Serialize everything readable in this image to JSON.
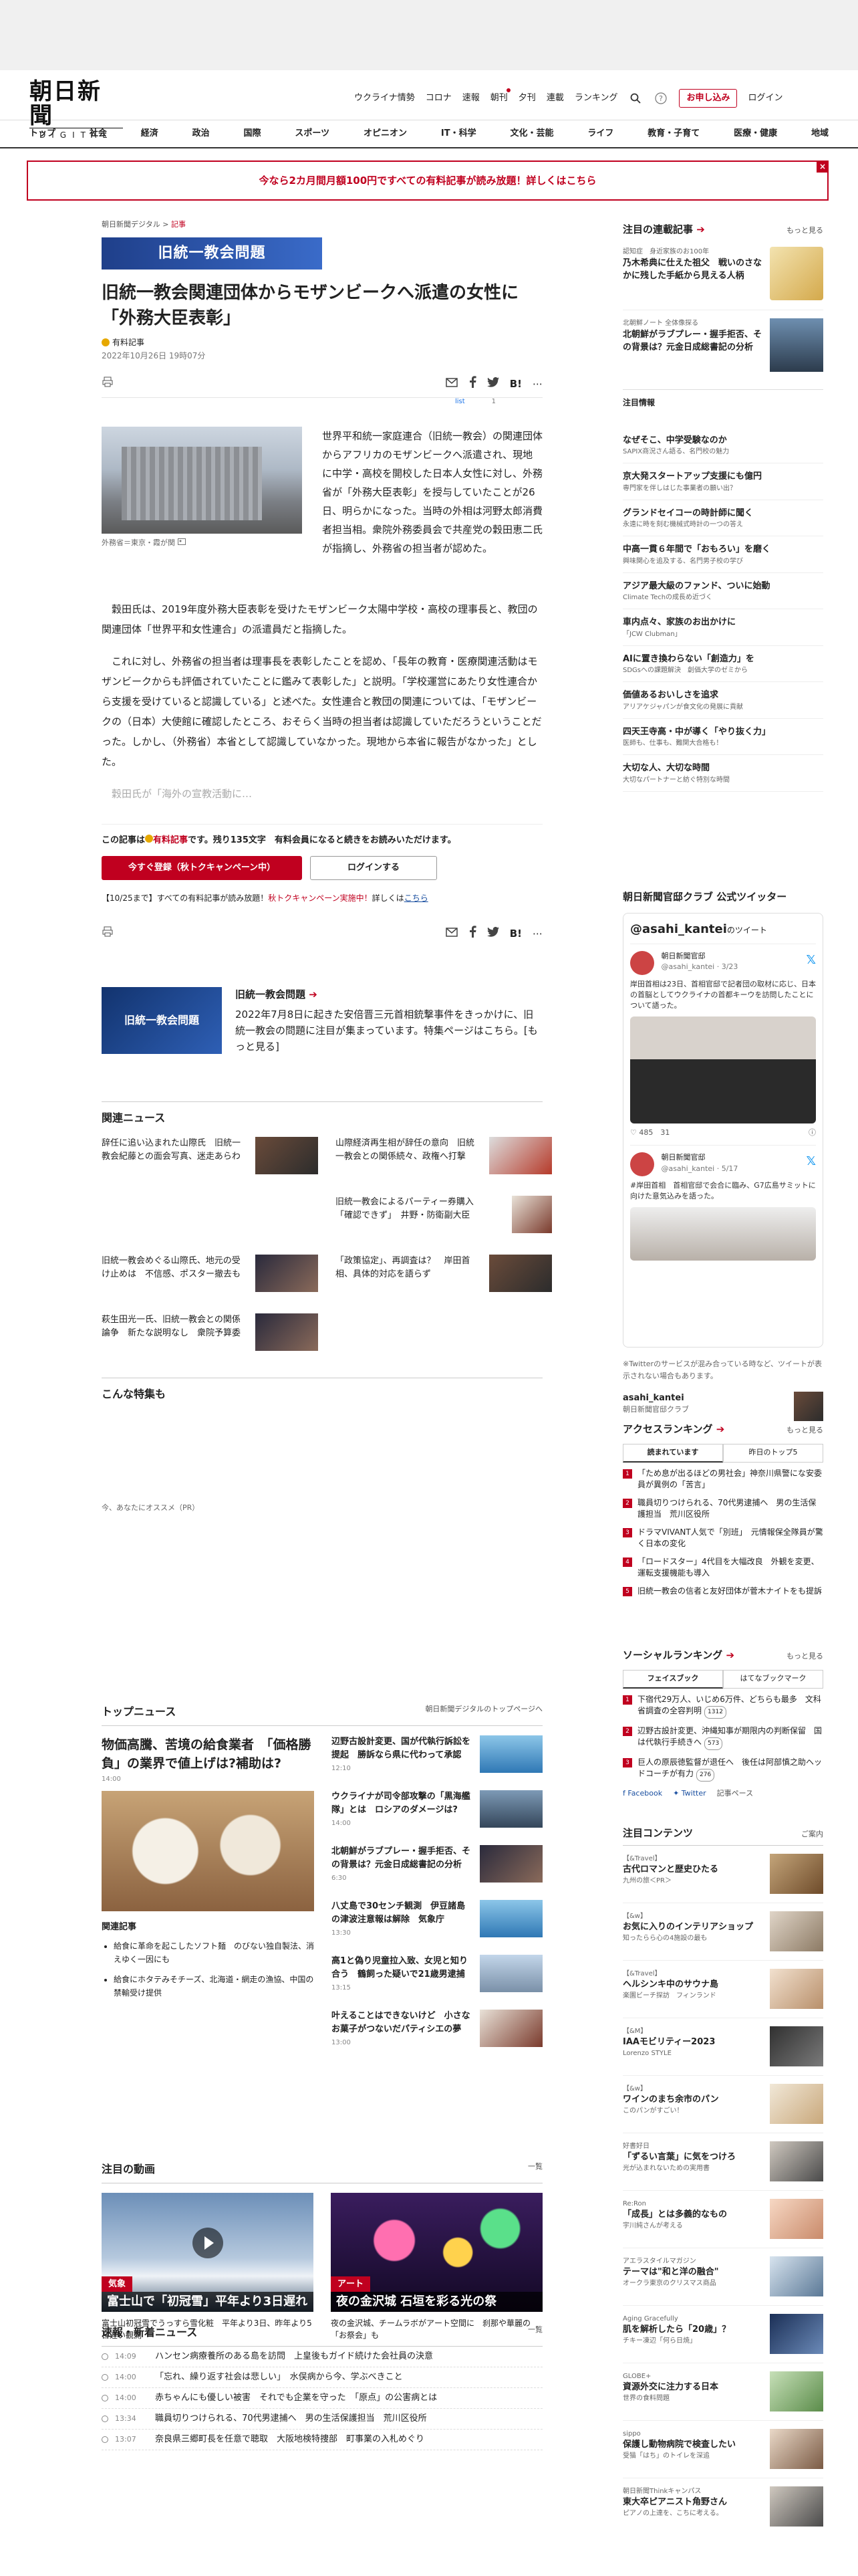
{
  "header": {
    "logo_main": "朝日新聞",
    "logo_sub": "DIGITAL",
    "util_links": [
      "ウクライナ情勢",
      "コロナ",
      "速報",
      "朝刊",
      "夕刊",
      "連載",
      "ランキング"
    ],
    "subscribe": "お申し込み",
    "login": "ログイン"
  },
  "nav": [
    "トップ",
    "社会",
    "経済",
    "政治",
    "国際",
    "スポーツ",
    "オピニオン",
    "IT・科学",
    "文化・芸能",
    "ライフ",
    "教育・子育て",
    "医療・健康",
    "地域"
  ],
  "banner": {
    "text": "今なら2カ月間月額100円ですべての有料記事が読み放題！詳しくはこちら",
    "close": "×"
  },
  "article": {
    "crumb_site": "朝日新聞デジタル",
    "crumb_sep": ">",
    "crumb_cat": "記事",
    "tag": "旧統一教会問題",
    "title": "旧統一教会関連団体からモザンビークへ派遣の女性に「外務大臣表彰」",
    "paid_label": "有料記事",
    "date": "2022年10月26日 19時07分",
    "share_small": "list",
    "share_count": "1",
    "photo_caption": "外務省＝東京・霞が関",
    "lead": "世界平和統一家庭連合（旧統一教会）の関連団体からアフリカのモザンビークへ派遣され、現地に中学・高校を開校した日本人女性に対し、外務省が「外務大臣表彰」を授与していたことが26日、明らかになった。当時の外相は河野太郎消費者担当相。衆院外務委員会で共産党の穀田恵二氏が指摘し、外務省の担当者が認めた。",
    "para1": "穀田氏は、2019年度外務大臣表彰を受けたモザンビーク太陽中学校・高校の理事長と、教団の関連団体「世界平和女性連合」の派遣員だと指摘した。",
    "para2": "これに対し、外務省の担当者は理事長を表彰したことを認め、「長年の教育・医療関連活動はモザンビークからも評価されていたことに鑑みて表彰した」と説明。「学校運営にあたり女性連合から支援を受けていると認識している」と述べた。女性連合と教団の関連については、「モザンビークの（日本）大使館に確認したところ、おそらく当時の担当者は認識していただろうということだった。しかし、（外務省）本省として認識していなかった。現地から本省に報告がなかった」とした。",
    "para3": "穀田氏が「海外の宣教活動に…",
    "pay_msg_a": "この記事は",
    "pay_msg_b": "有料記事",
    "pay_msg_c": "です。残り135文字　有料会員になると続きをお読みいただけます。",
    "btn_register": "今すぐ登録（秋トクキャンペーン中）",
    "btn_login": "ログインする",
    "note_a": "【10/25まで】すべての有料記事が読み放題！",
    "note_b": "秋トクキャンペーン実施中！",
    "note_c": "詳しくは",
    "note_d": "こちら"
  },
  "feature": {
    "img_text": "旧統一教会問題",
    "title": "旧統一教会問題",
    "desc": "2022年7月8日に起きた安倍晋三元首相銃撃事件をきっかけに、旧統一教会の問題に注目が集まっています。特集ページはこちら。[もっと見る]"
  },
  "related": {
    "heading": "関連ニュース",
    "items": [
      "辞任に追い込まれた山際氏　旧統一教会紀藤との面会写真、迷走あらわ",
      "山際経済再生相が辞任の意向　旧統一教会との関係続々、政権へ打撃",
      "旧統一教会によるパーティー券購入「確認できず」　井野・防衛副大臣",
      "旧統一教会めぐる山際氏、地元の受け止めは　不信感、ポスター撤去も",
      "「政策協定」、再調査は？　岸田首相、具体的対応を語らず",
      "萩生田光一氏、旧統一教会との関係論争　新たな説明なし　衆院予算委"
    ]
  },
  "konna": "こんな特集も",
  "pr": "今、あなたにオススメ（PR）",
  "topnews": {
    "heading": "トップニュース",
    "more": "朝日新聞デジタルのトップページへ",
    "lead_title": "物価高騰、苦境の給食業者　「価格勝負」の業界で値上げは?補助は?",
    "lead_time": "14:00",
    "kanren_heading": "関連記事",
    "kanren": [
      "給食に革命を起こしたソフト麺　のびない独自製法、消えゆく一因にも",
      "給食にホタテみそチーズ、北海道・網走の漁協、中国の禁輸受け提供"
    ],
    "items": [
      {
        "title": "辺野古設計変更、国が代執行訴訟を提起　勝訴なら県に代わって承認",
        "time": "12:10"
      },
      {
        "title": "ウクライナが司令部攻撃の「黒海艦隊」とは　ロシアのダメージは?",
        "time": "14:00"
      },
      {
        "title": "北朝鮮がラブプレー・握手拒否、その背景は？元金日成総書記の分析",
        "time": "6:30"
      },
      {
        "title": "八丈島で30センチ観測　伊豆諸島の津波注意報は解除　気象庁",
        "time": "13:30"
      },
      {
        "title": "高1と偽り児童拉入致、女児と知り合う　鶴飼った疑いで21歳男逮捕",
        "time": "13:15"
      },
      {
        "title": "叶えることはできないけど　小さなお菓子がつないだパティシエの夢",
        "time": "13:00"
      }
    ]
  },
  "videos": {
    "heading": "注目の動画",
    "more": "一覧",
    "items": [
      {
        "badge": "気象",
        "caption": "富士山で「初冠雪」平年より3日遅れ",
        "desc": "富士山初冠雪でうっすら雪化粧　平年より3日、昨年より5日遅い観測"
      },
      {
        "badge": "アート",
        "caption": "夜の金沢城 石垣を彩る光の祭",
        "desc": "夜の金沢城、チームラボがアート空間に　刹那や華麗の「お祭会」も"
      }
    ]
  },
  "breaking": {
    "heading": "速報・新着ニュース",
    "more": "一覧",
    "items": [
      {
        "time": "14:09",
        "title": "ハンセン病療養所のある島を訪問　上皇後もガイド続けた会社員の決意"
      },
      {
        "time": "14:00",
        "title": "「忘れ、繰り返す社会は悲しい」　水俣病から今、学ぶべきこと"
      },
      {
        "time": "14:00",
        "title": "赤ちゃんにも優しい被害　それでも企業を守った　「原点」の公害病とは"
      },
      {
        "time": "13:34",
        "title": "職員切りつけられる、70代男逮捕へ　男の生活保護担当　荒川区役所"
      },
      {
        "time": "13:07",
        "title": "奈良県三郷町長を任意で聴取　大阪地検特捜部　町事業の入札めぐり"
      }
    ]
  },
  "side_series": {
    "heading": "注目の連載記事",
    "more": "もっと見る",
    "items": [
      {
        "kicker": "認知症　身近家族のお100年",
        "title": "乃木希典に仕えた祖父　戦いのさなかに残した手紙から見える人柄"
      },
      {
        "kicker": "北朝鮮ノート 全体像探る",
        "title": "北朝鮮がラブプレー・握手拒否、その背景は？元金日成総書記の分析"
      }
    ],
    "chuui": "注目情報",
    "ads": [
      {
        "title": "なぜそこ、中学受験なのか",
        "sub": "SAPIX商況さん語る、名門校の魅力"
      },
      {
        "title": "京大発スタートアップ支援にも億円",
        "sub": "専門家を伴しはじた事業者の願い出？"
      },
      {
        "title": "グランドセイコーの時計師に聞く",
        "sub": "永遠に時を刻む機械式時計の一つの答え"
      },
      {
        "title": "中高一貫６年間で「おもろい」を磨く",
        "sub": "興味関心を追及する、名門男子校の学び"
      },
      {
        "title": "アジア最大級のファンド、ついに始動",
        "sub": "Climate Techの成長め近づく"
      },
      {
        "title": "車内点々、家族のお出かけに",
        "sub": "「JCW Clubman」"
      },
      {
        "title": "AIに置き換わらない「創造力」を",
        "sub": "SDGsへの課題解決　創価大学のゼミから"
      },
      {
        "title": "価値あるおいしさを追求",
        "sub": "アリアケジャパンが食文化の発展に貢献"
      },
      {
        "title": "四天王寺高・中が導く「やり抜く力」",
        "sub": "医師も、仕事も、難関大合格も！"
      },
      {
        "title": "大切な人、大切な時間",
        "sub": "大切なパートナーと紡ぐ特別な時間"
      }
    ]
  },
  "club": {
    "heading": "朝日新聞官邸クラブ 公式ツイッター",
    "handle": "@asahi_kantei",
    "handle_suffix": "のツイート",
    "tweet1_name": "朝日新聞官邸",
    "tweet1_meta": "@asahi_kantei · 3/23",
    "tweet1_text": "岸田首相は23日、首相官邸で記者団の取材に応じ、日本の首脳としてウクライナの首都キーウを訪問したことについて語った。",
    "tweet1_stats": "485　31",
    "tweet2_name": "朝日新聞官邸",
    "tweet2_meta": "@asahi_kantei · 5/17",
    "tweet2_text": "#岸田首相　首相官邸で会合に臨み、G7広島サミットに向けた意気込みを語った。",
    "note": "※Twitterのサービスが混み合っている時など、ツイートが表示されない場合もあります。",
    "acct_name": "asahi_kantei",
    "acct_sub": "朝日新聞官邸クラブ"
  },
  "access_rank": {
    "heading": "アクセスランキング",
    "more": "もっと見る",
    "tab1": "読まれています",
    "tab2": "昨日のトップ5",
    "items": [
      "「ため息が出るほどの男社会」神奈川県警にな安委員が異例の「苦言」",
      "職員切りつけられる、70代男逮捕へ　男の生活保護担当　荒川区役所",
      "ドラマVIVANT人気で「別班」　元情報保全隊員が驚く日本の変化",
      "「ロードスター」4代目を大幅改良　外観を変更、運転支援機能も導入",
      "旧統一教会の信者と友好団体が菅木ナイトをも提訴"
    ]
  },
  "social_rank": {
    "heading": "ソーシャルランキング",
    "more": "もっと見る",
    "tab1": "フェイスブック",
    "tab2": "はてなブックマーク",
    "items": [
      {
        "text": "下宿代29万人、いじめ6万件、どちらも最多　文科省調査の全容判明",
        "count": "1312"
      },
      {
        "text": "辺野古設計変更、沖縄知事が期限内の判断保留　国は代執行手続きへ",
        "count": "573"
      },
      {
        "text": "巨人の原辰徳監督が退任へ　後任は阿部慎之助ヘッドコーチが有力",
        "count": "276"
      }
    ],
    "share_fb": "Facebook",
    "share_tw": "Twitter",
    "share_rec": "記事ペース"
  },
  "content": {
    "heading": "注目コンテンツ",
    "more": "ご案内",
    "items": [
      {
        "kicker": "【&Travel】",
        "title": "古代ロマンと歴史ひたる",
        "sub": "九州の旅＜PR＞"
      },
      {
        "kicker": "【&w】",
        "title": "お気に入りのインテリアショップ",
        "sub": "知ったらら心の4施設の最も"
      },
      {
        "kicker": "【&Travel】",
        "title": "ヘルシンキ中のサウナ島",
        "sub": "楽園ビーチ探訪　フィンランド"
      },
      {
        "kicker": "【&M】",
        "title": "IAAモビリティー2023",
        "sub": "Lorenzo STYLE"
      },
      {
        "kicker": "【&w】",
        "title": "ワインのまち余市のパン",
        "sub": "このパンがすごい！"
      },
      {
        "kicker": "好書好日",
        "title": "「ずるい言葉」に気をつけろ",
        "sub": "光が込まれないための実用書"
      },
      {
        "kicker": "Re:Ron",
        "title": "「成長」とは多義的なもの",
        "sub": "宇川純さんが考える"
      },
      {
        "kicker": "アエラスタイルマガジン",
        "title": "テーマは\"和と洋の融合\"",
        "sub": "オークラ東京のクリスマス商品"
      },
      {
        "kicker": "Aging Gracefully",
        "title": "肌を解析したら「20歳」？",
        "sub": "チキー凍辺「何ら日焼」"
      },
      {
        "kicker": "GLOBE+",
        "title": "資源外交に注力する日本",
        "sub": "世界の食料問題"
      },
      {
        "kicker": "sippo",
        "title": "保護し動物病院で検査したい",
        "sub": "受猫「はち」のトイレを深追"
      },
      {
        "kicker": "朝日新聞Thinkキャンパス",
        "title": "東大卒ピアニスト角野さん",
        "sub": "ピアノの上達を、こちに考える。"
      }
    ]
  }
}
